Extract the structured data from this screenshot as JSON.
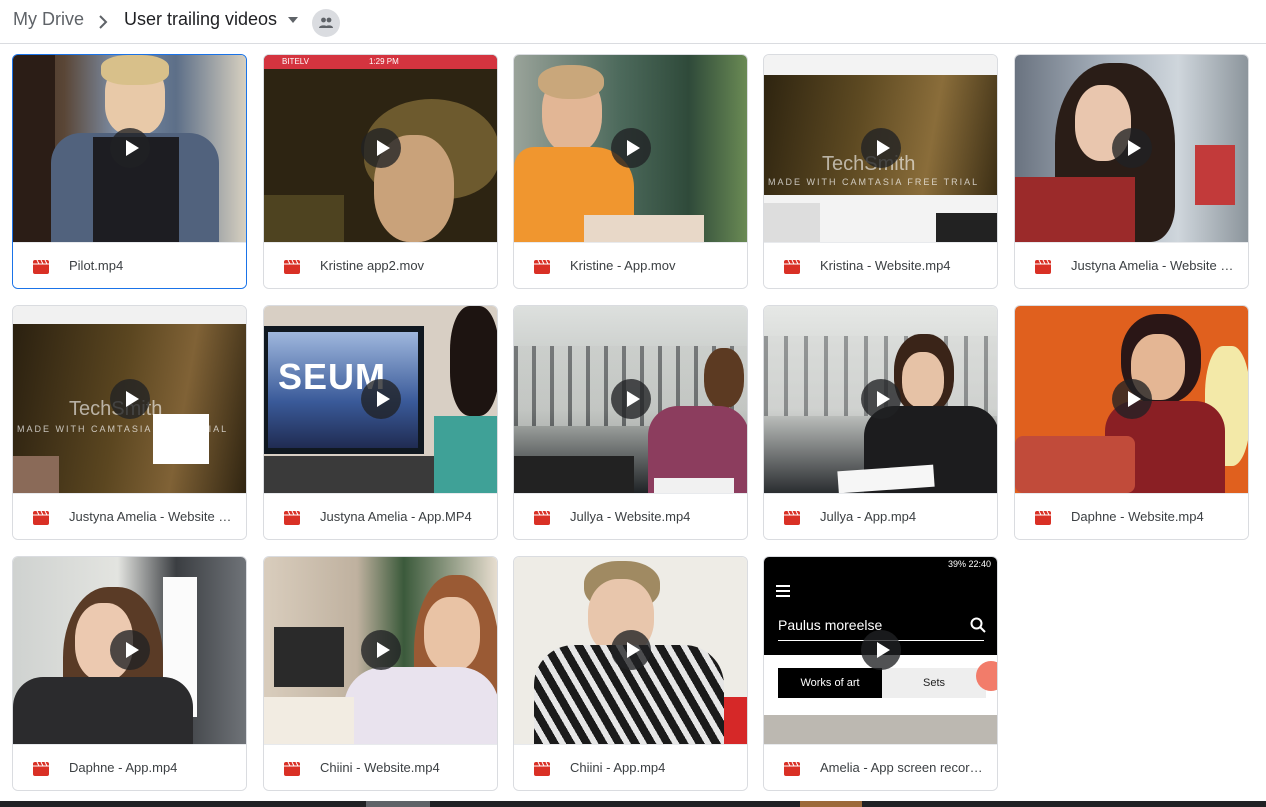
{
  "breadcrumb": {
    "root": "My Drive",
    "current": "User trailing videos"
  },
  "thumb_text": {
    "status_carrier": "BITELV",
    "status_time": "1:29 PM",
    "watermark_brand": "TechSmith",
    "watermark_trial": "MADE WITH CAMTASIA FREE TRIAL",
    "museum_word": "SEUM",
    "phone_status": "39% 22:40",
    "phone_search": "Paulus moreelse",
    "phone_tab_active": "Works of art",
    "phone_tab_idle": "Sets"
  },
  "files": [
    {
      "name": "Pilot.mp4"
    },
    {
      "name": "Kristine app2.mov"
    },
    {
      "name": "Kristine - App.mov"
    },
    {
      "name": "Kristina - Website.mp4"
    },
    {
      "name": "Justyna Amelia - Website …"
    },
    {
      "name": "Justyna Amelia - Website …"
    },
    {
      "name": "Justyna Amelia - App.MP4"
    },
    {
      "name": "Jullya - Website.mp4"
    },
    {
      "name": "Jullya - App.mp4"
    },
    {
      "name": "Daphne - Website.mp4"
    },
    {
      "name": "Daphne - App.mp4"
    },
    {
      "name": "Chiini - Website.mp4"
    },
    {
      "name": "Chiini - App.mp4"
    },
    {
      "name": "Amelia - App screen record…"
    }
  ],
  "colors": {
    "video_icon": "#d93025",
    "selected_border": "#1a73e8"
  }
}
